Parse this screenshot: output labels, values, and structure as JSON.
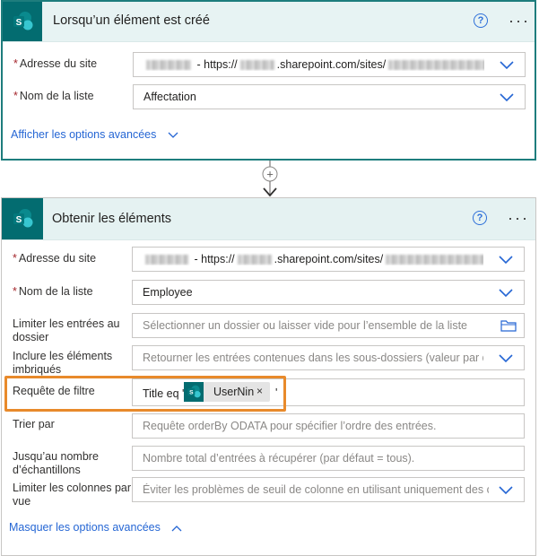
{
  "trigger": {
    "title": "Lorsqu’un élément est créé",
    "help_glyph": "?",
    "more_glyph": "···",
    "site_label": "Adresse du site",
    "site_value_prefix": "- https://",
    "site_value_mid": ".sharepoint.com/sites/",
    "list_label": "Nom de la liste",
    "list_value": "Affectation",
    "advanced_link": "Afficher les options avancées"
  },
  "connector": {
    "add_glyph": "+"
  },
  "action": {
    "title": "Obtenir les éléments",
    "help_glyph": "?",
    "more_glyph": "···",
    "site_label": "Adresse du site",
    "site_value_prefix": "- https://",
    "site_value_mid": ".sharepoint.com/sites/",
    "list_label": "Nom de la liste",
    "list_value": "Employee",
    "limit_entries_label": "Limiter les entrées au dossier",
    "limit_entries_placeholder": "Sélectionner un dossier ou laisser vide pour l’ensemble de la liste",
    "nested_label": "Inclure les éléments imbriqués",
    "nested_placeholder": "Retourner les entrées contenues dans les sous-dossiers (valeur par défaut",
    "filter_label": "Requête de filtre",
    "filter_prefix": "Title eq '",
    "filter_token": "UserNin",
    "filter_token_remove": "×",
    "filter_suffix": "'",
    "orderby_label": "Trier par",
    "orderby_placeholder": "Requête orderBy ODATA pour spécifier l’ordre des entrées.",
    "top_label": "Jusqu’au nombre d’échantillons",
    "top_placeholder": "Nombre total d’entrées à récupérer (par défaut = tous).",
    "columns_label": "Limiter les colonnes par vue",
    "columns_placeholder": "Éviter les problèmes de seuil de colonne en utilisant uniquement des colonnes",
    "advanced_link": "Masquer les options avancées"
  },
  "colors": {
    "sharepoint_teal": "#036c70",
    "highlight": "#e88a2b",
    "link": "#2566d4",
    "required": "#a4262c"
  },
  "required_mark": "*"
}
